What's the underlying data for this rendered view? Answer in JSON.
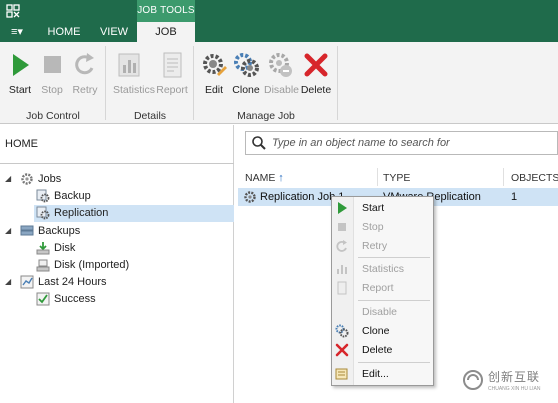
{
  "titlebar": {
    "contextual_tab_group": "JOB TOOLS"
  },
  "tabs": [
    {
      "label": "HOME"
    },
    {
      "label": "VIEW"
    },
    {
      "label": "JOB"
    }
  ],
  "menu_button": {
    "icon": "hamburger-menu-icon",
    "glyph": "≡▾"
  },
  "ribbon": {
    "groups": [
      {
        "label": "Job Control",
        "buttons": [
          {
            "label": "Start",
            "icon": "play-icon",
            "enabled": true
          },
          {
            "label": "Stop",
            "icon": "stop-icon",
            "enabled": false
          },
          {
            "label": "Retry",
            "icon": "retry-icon",
            "enabled": false
          }
        ]
      },
      {
        "label": "Details",
        "buttons": [
          {
            "label": "Statistics",
            "icon": "statistics-icon",
            "enabled": false
          },
          {
            "label": "Report",
            "icon": "report-icon",
            "enabled": false
          }
        ]
      },
      {
        "label": "Manage Job",
        "buttons": [
          {
            "label": "Edit",
            "icon": "edit-gear-icon",
            "enabled": true
          },
          {
            "label": "Clone",
            "icon": "clone-gear-icon",
            "enabled": true
          },
          {
            "label": "Disable",
            "icon": "disable-gear-icon",
            "enabled": false
          },
          {
            "label": "Delete",
            "icon": "delete-x-icon",
            "enabled": true
          }
        ]
      }
    ]
  },
  "nav": {
    "title": "HOME",
    "tree": [
      {
        "label": "Jobs",
        "level": 0,
        "expanded": true
      },
      {
        "label": "Backup",
        "level": 1
      },
      {
        "label": "Replication",
        "level": 1,
        "selected": true
      },
      {
        "label": "Backups",
        "level": 0,
        "expanded": true
      },
      {
        "label": "Disk",
        "level": 1
      },
      {
        "label": "Disk (Imported)",
        "level": 1
      },
      {
        "label": "Last 24 Hours",
        "level": 0,
        "expanded": true
      },
      {
        "label": "Success",
        "level": 1
      }
    ]
  },
  "search": {
    "placeholder": "Type in an object name to search for"
  },
  "table": {
    "columns": [
      "NAME",
      "TYPE",
      "OBJECTS"
    ],
    "sort_indicator": "↑",
    "rows": [
      {
        "name": "Replication Job 1",
        "type": "VMware Replication",
        "objects": "1"
      }
    ]
  },
  "context_menu": {
    "items": [
      {
        "label": "Start",
        "icon": "play-icon",
        "enabled": true
      },
      {
        "label": "Stop",
        "icon": "stop-icon",
        "enabled": false
      },
      {
        "label": "Retry",
        "icon": "retry-icon",
        "enabled": false
      },
      {
        "label": "Statistics",
        "icon": "statistics-icon",
        "enabled": false
      },
      {
        "label": "Report",
        "icon": "report-icon",
        "enabled": false
      },
      {
        "label": "Disable",
        "icon": "disable-gear-icon",
        "enabled": false
      },
      {
        "label": "Clone",
        "icon": "clone-gear-icon",
        "enabled": true
      },
      {
        "label": "Delete",
        "icon": "delete-x-icon",
        "enabled": true
      },
      {
        "label": "Edit...",
        "icon": "edit-icon",
        "enabled": true
      }
    ]
  },
  "watermark": {
    "text": "创新互联",
    "sub": "CHUANG XIN HU LIAN"
  },
  "colors": {
    "titlebar": "#1f6b4b",
    "contextual_tab": "#3c9a6d",
    "ribbon_bg": "#f3f3f3",
    "selection": "#cfe3f5",
    "play_green": "#2f9a3a",
    "delete_red": "#d7262b"
  }
}
